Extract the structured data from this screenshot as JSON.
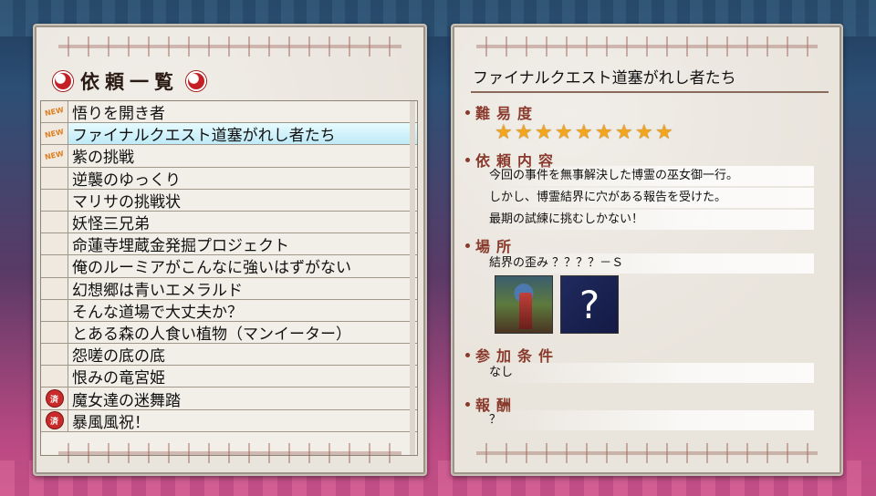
{
  "quest_list": {
    "title": "依頼一覧",
    "items": [
      {
        "name": "悟りを開き者",
        "badge": "NEW",
        "selected": false
      },
      {
        "name": "ファイナルクエスト道塞がれし者たち",
        "badge": "NEW",
        "selected": true
      },
      {
        "name": "紫の挑戦",
        "badge": "NEW",
        "selected": false
      },
      {
        "name": "逆襲のゆっくり",
        "badge": "",
        "selected": false
      },
      {
        "name": "マリサの挑戦状",
        "badge": "",
        "selected": false
      },
      {
        "name": "妖怪三兄弟",
        "badge": "",
        "selected": false
      },
      {
        "name": "命蓮寺埋蔵金発掘プロジェクト",
        "badge": "",
        "selected": false
      },
      {
        "name": "俺のルーミアがこんなに強いはずがない",
        "badge": "",
        "selected": false
      },
      {
        "name": "幻想郷は青いエメラルド",
        "badge": "",
        "selected": false
      },
      {
        "name": "そんな道場で大丈夫か？",
        "badge": "",
        "selected": false
      },
      {
        "name": "とある森の人食い植物（マンイーター）",
        "badge": "",
        "selected": false
      },
      {
        "name": "怨嗟の底の底",
        "badge": "",
        "selected": false
      },
      {
        "name": "恨みの竜宮姫",
        "badge": "",
        "selected": false
      },
      {
        "name": "魔女達の迷舞踏",
        "badge": "済",
        "selected": false
      },
      {
        "name": "暴風風祝！",
        "badge": "済",
        "selected": false
      }
    ]
  },
  "detail": {
    "title": "ファイナルクエスト道塞がれし者たち",
    "difficulty_label": "難易度",
    "difficulty_stars": 9,
    "content_label": "依頼内容",
    "content_lines": [
      "今回の事件を無事解決した博霊の巫女御一行。",
      "しかし、博霊結界に穴がある報告を受けた。",
      "最期の試練に挑むしかない！"
    ],
    "location_label": "場所",
    "location_text": "結界の歪み ？？？？－Ｓ",
    "location_unknown_mark": "?",
    "condition_label": "参加条件",
    "condition_text": "なし",
    "reward_label": "報酬",
    "reward_text": "？"
  },
  "colors": {
    "star": "#f2a51d",
    "section_label": "#8a3a2c",
    "selected_row": "#bfeaf7",
    "new_badge": "#e08022",
    "done_badge": "#c92b2b"
  }
}
